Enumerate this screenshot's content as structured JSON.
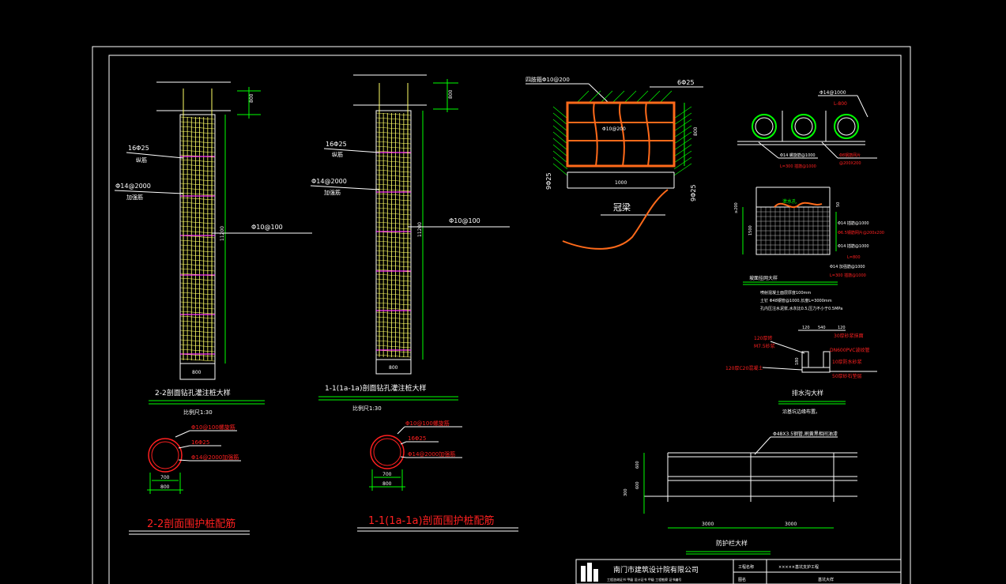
{
  "colors": {
    "background": "#000000",
    "frame": "#ffffff",
    "cage": "#ffff66",
    "dim": "#00ff00",
    "red": "#ff2020",
    "magenta": "#ff33ff",
    "orange": "#ff6a1a"
  },
  "left_pile": {
    "dim_top": "800",
    "dim_height": "11200",
    "dim_width": "800",
    "label_main": "16Φ25",
    "label_main_sub": "纵筋",
    "label_hoop": "Φ14@2000",
    "label_hoop_sub": "加强筋",
    "label_spiral": "Φ10@100",
    "title": "2-2剖面钻孔灌注桩大样",
    "subtitle": "比例尺1:30"
  },
  "mid_pile": {
    "dim_top": "800",
    "dim_height": "11200",
    "dim_width": "800",
    "label_main": "16Φ25",
    "label_main_sub": "纵筋",
    "label_hoop": "Φ14@2000",
    "label_hoop_sub": "加强筋",
    "label_spiral": "Φ10@100",
    "title": "1-1(1a-1a)剖面钻孔灌注桩大样",
    "subtitle": "比例尺1:30"
  },
  "left_section": {
    "l1": "Φ10@100螺旋筋",
    "l2": "16Φ25",
    "l3": "Φ14@2000加强筋",
    "d1": "700",
    "d2": "800",
    "title": "2-2剖面围护桩配筋"
  },
  "mid_section": {
    "l1": "Φ10@100螺旋筋",
    "l2": "16Φ25",
    "l3": "Φ14@2000加强筋",
    "d1": "700",
    "d2": "800",
    "title": "1-1(1a-1a)剖面围护桩配筋"
  },
  "cap_beam": {
    "label_stirrup": "四肢箍Φ10@200",
    "label_top": "6Φ25",
    "label_left": "9Φ25",
    "label_right": "9Φ25",
    "label_center": "Φ10@200",
    "width": "1000",
    "height": "800",
    "title": "冠梁"
  },
  "pipes": {
    "label_top": "Φ14@1000",
    "label_l": "L-800",
    "label_a": "Φ14 螺旋筋@1000",
    "label_b": "L=300 插筋@1000",
    "label_c": "Φ8钢筋网片",
    "label_d": "@200X200"
  },
  "slope": {
    "t1": "泄水孔",
    "r1": "Φ14 插筋@1000",
    "r2": "Φ6.5钢筋网片@200x200",
    "r3": "Φ14 插筋@1000",
    "r4": "L=800",
    "r5": "Φ14 加强筋@1000",
    "r6": "L=300 插筋@1000",
    "dim_l": "≥200",
    "dim_v": "1500",
    "dim_r": "50",
    "title": "坡面挂网大样",
    "n1": "喷射混凝土面层厚度100mm",
    "n2": "土钉 Φ48钢管@1000,长度L=3000mm",
    "n3": "孔内压注水泥浆,水灰比0.5,压力不小于0.5MPa"
  },
  "ditch": {
    "a": "120",
    "b": "540",
    "c": "120",
    "l1": "120厚砖",
    "l2": "M7.5砂浆",
    "l3": "120厚C20混凝土",
    "r1": "30厚砂浆抹面",
    "r2": "DN600PVC波纹管",
    "r3": "10厚防水砂浆",
    "r4": "50厚砂石垫层",
    "h": "180",
    "title": "排水沟大样",
    "note": "沿基坑边缘布置。"
  },
  "fence": {
    "label": "Φ48X3.5钢管,刷黄黑相间油漆",
    "h1": "600",
    "h2": "600",
    "h3": "300",
    "s1": "3000",
    "s2": "3000",
    "title": "防护栏大样"
  },
  "title_block": {
    "company": "南门市建筑设计院有限公司",
    "company_sub": "工程咨询证书 甲级 设计证书 甲级 工程勘察 证书编号",
    "project_label": "工程名称",
    "project_value": "×××××基坑支护工程",
    "drawing_label": "图名",
    "drawing_value": "基坑大样"
  }
}
